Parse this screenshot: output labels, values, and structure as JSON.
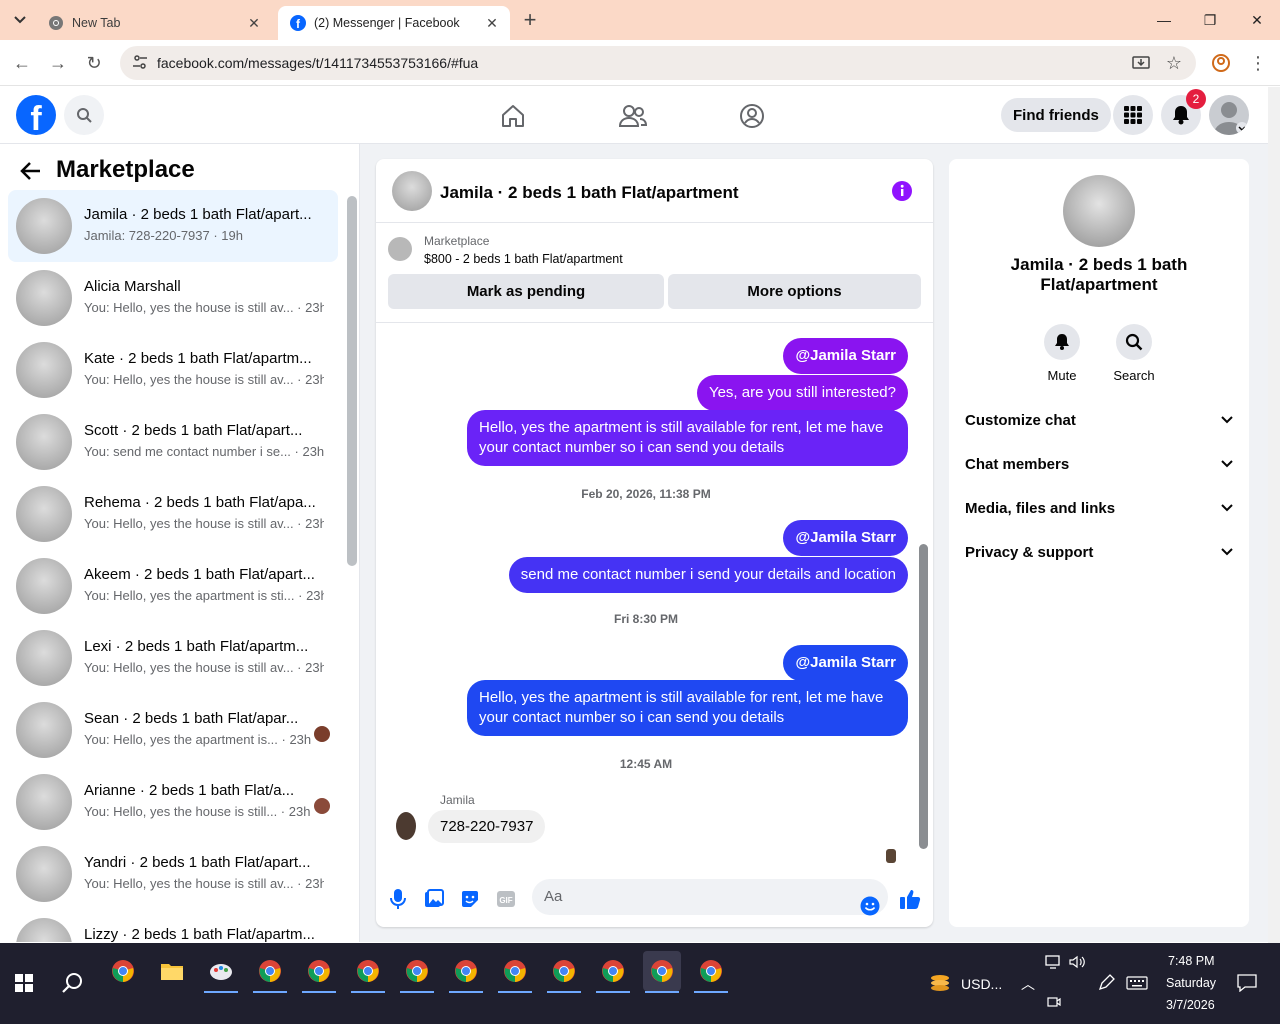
{
  "browser": {
    "tabs": [
      {
        "title": "New Tab"
      },
      {
        "title": "(2) Messenger | Facebook"
      }
    ],
    "url": "facebook.com/messages/t/1411734553753166/#fua"
  },
  "header": {
    "find_friends": "Find friends",
    "notification_count": "2"
  },
  "left": {
    "title": "Marketplace",
    "conversations": [
      {
        "name": "Jamila · 2 beds 1 bath Flat/apart...",
        "snippet": "Jamila: 728-220-7937 · 19h"
      },
      {
        "name": "Alicia Marshall",
        "snippet": "You: Hello, yes the house is still av... · 23h"
      },
      {
        "name": "Kate · 2 beds 1 bath Flat/apartm...",
        "snippet": "You: Hello, yes the house is still av... · 23h"
      },
      {
        "name": "Scott · 2 beds 1 bath Flat/apart...",
        "snippet": "You: send me contact number i se... · 23h"
      },
      {
        "name": "Rehema · 2 beds 1 bath Flat/apa...",
        "snippet": "You: Hello, yes the house is still av... · 23h"
      },
      {
        "name": "Akeem · 2 beds 1 bath Flat/apart...",
        "snippet": "You: Hello, yes the apartment is sti... · 23h"
      },
      {
        "name": "Lexi · 2 beds 1 bath Flat/apartm...",
        "snippet": "You: Hello, yes the house is still av... · 23h"
      },
      {
        "name": "Sean · 2 beds 1 bath Flat/apar...",
        "snippet": "You: Hello, yes the apartment is... · 23h"
      },
      {
        "name": "Arianne · 2 beds 1 bath Flat/a...",
        "snippet": "You: Hello, yes the house is still... · 23h"
      },
      {
        "name": "Yandri · 2 beds 1 bath Flat/apart...",
        "snippet": "You: Hello, yes the house is still av... · 23h"
      },
      {
        "name": "Lizzy · 2 beds 1 bath Flat/apartm...",
        "snippet": ""
      }
    ]
  },
  "chat": {
    "title": "Jamila · 2 beds 1 bath Flat/apartment",
    "marketplace_label": "Marketplace",
    "listing": "$800 - 2 beds 1 bath Flat/apartment",
    "mark_pending": "Mark as pending",
    "more_options": "More options",
    "messages": {
      "m1": "@Jamila Starr",
      "m2": "Yes, are you still interested?",
      "m3": "Hello, yes the apartment is still available for rent, let me have your contact number so i can send you details",
      "t1": "Feb 20, 2026, 11:38 PM",
      "m4": "@Jamila Starr",
      "m5": "send me contact number i send your details and location",
      "t2": "Fri 8:30 PM",
      "m6": "@Jamila Starr",
      "m7": "Hello, yes the apartment is still available for rent, let me have your contact number so i can send you details",
      "t3": "12:45 AM",
      "sender": "Jamila",
      "m8": "728-220-7937"
    },
    "composer_placeholder": "Aa"
  },
  "right": {
    "name": "Jamila · 2 beds 1 bath Flat/apartment",
    "mute": "Mute",
    "search": "Search",
    "items": [
      "Customize chat",
      "Chat members",
      "Media, files and links",
      "Privacy & support"
    ]
  },
  "taskbar": {
    "currency": "USD...",
    "time": "7:48 PM",
    "day": "Saturday",
    "date": "3/7/2026"
  },
  "colors": {
    "fb_blue": "#0866ff",
    "tabbar": "#fbd9c7",
    "bubble_purple": "#8a14f0",
    "bubble_blue": "#1f48f2"
  }
}
